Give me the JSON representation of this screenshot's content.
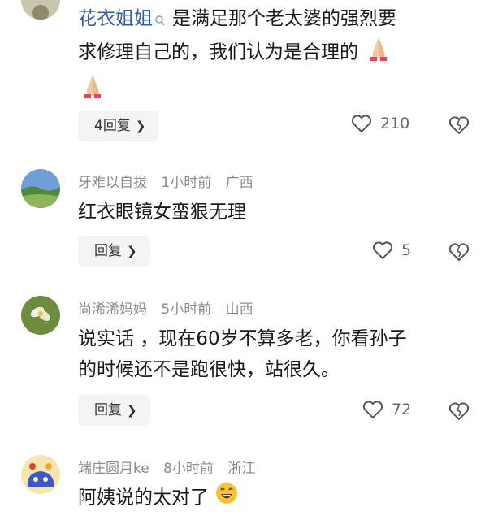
{
  "comments": [
    {
      "author": "花衣姐姐",
      "text_a": "是满足那个老太婆的强烈要",
      "text_b": "求修理自己的，我们认为是合理的",
      "reply_label": "4回复",
      "likes": "210"
    },
    {
      "author": "牙难以自拔",
      "time": "1小时前",
      "region": "广西",
      "text": "红衣眼镜女蛮狠无理",
      "reply_label": "回复",
      "likes": "5"
    },
    {
      "author": "尚浠浠妈妈",
      "time": "5小时前",
      "region": "山西",
      "text_line1": "说实话 ，现在60岁不算多老，你看孙子",
      "text_line2": "的时候还不是跑很快，站很久。",
      "reply_label": "回复",
      "likes": "72"
    },
    {
      "author": "端庄圆月ke",
      "time": "8小时前",
      "region": "浙江",
      "text": "阿姨说的太对了"
    }
  ],
  "icons": {
    "like": "heart-outline-icon",
    "dislike": "broken-heart-icon",
    "reply_chevron": "chevron-right-icon",
    "verified": "search-badge-icon",
    "emoji_pray": "praying-hands-icon",
    "emoji_laugh": "laughing-face-icon"
  },
  "colors": {
    "author_highlight": "#2e5fa8",
    "meta": "#8c8c8c",
    "reply_bg": "#f4f4f5"
  }
}
